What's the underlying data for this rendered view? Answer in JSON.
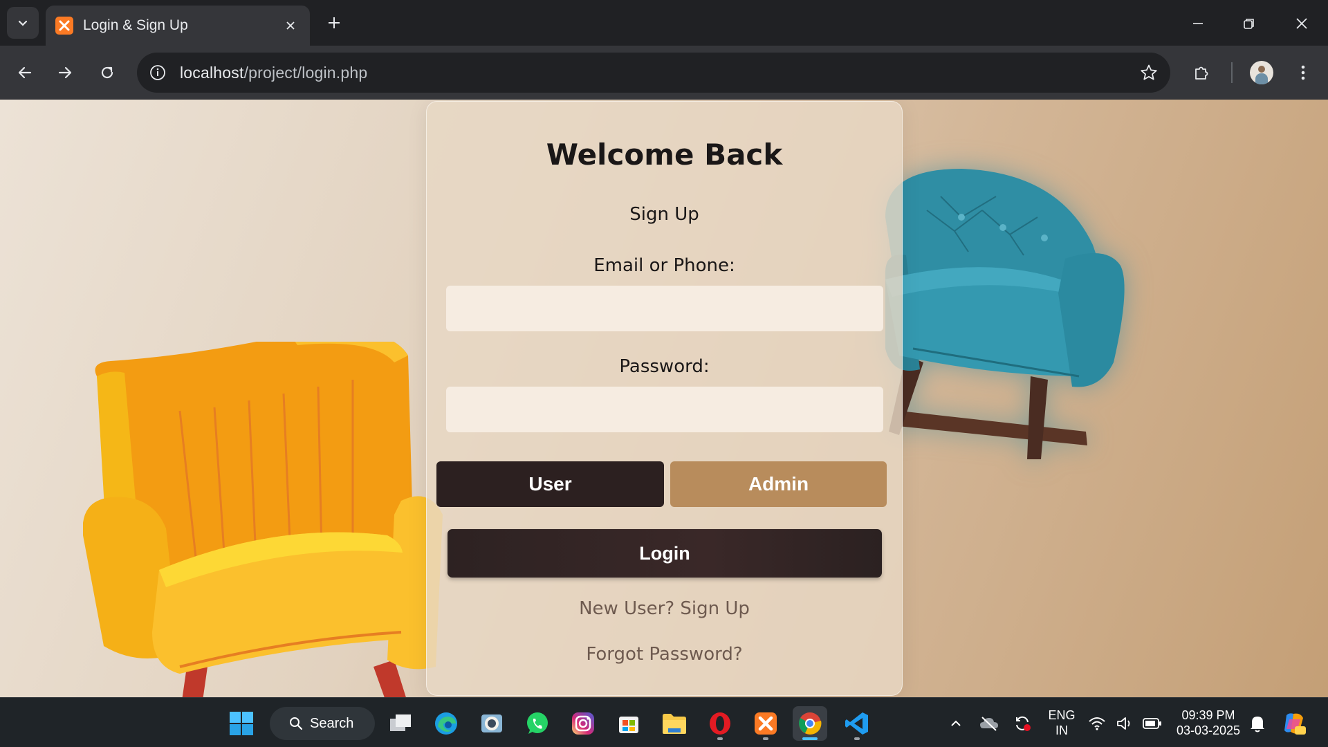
{
  "browser": {
    "tab_title": "Login & Sign Up",
    "url_host": "localhost",
    "url_path": "/project/login.php"
  },
  "page": {
    "heading": "Welcome Back",
    "subtitle": "Sign Up",
    "email_label": "Email or Phone:",
    "email_value": "",
    "password_label": "Password:",
    "password_value": "",
    "role_user": "User",
    "role_admin": "Admin",
    "login_button": "Login",
    "signup_link": "New User? Sign Up",
    "forgot_link": "Forgot Password?"
  },
  "taskbar": {
    "search_label": "Search",
    "language": "ENG",
    "region": "IN",
    "time": "09:39 PM",
    "date": "03-03-2025",
    "apps": [
      "start-icon",
      "task-view-icon",
      "edge-icon",
      "photos-icon",
      "whatsapp-icon",
      "instagram-icon",
      "store-icon",
      "file-explorer-icon",
      "opera-icon",
      "xampp-icon",
      "chrome-icon",
      "vscode-icon"
    ]
  },
  "colors": {
    "role_user_bg": "#2c2020",
    "role_admin_bg": "#b88c5c",
    "login_bg": "#2d2222",
    "chair_yellow": "#f6a01a",
    "chair_blue": "#2f8ea4"
  }
}
